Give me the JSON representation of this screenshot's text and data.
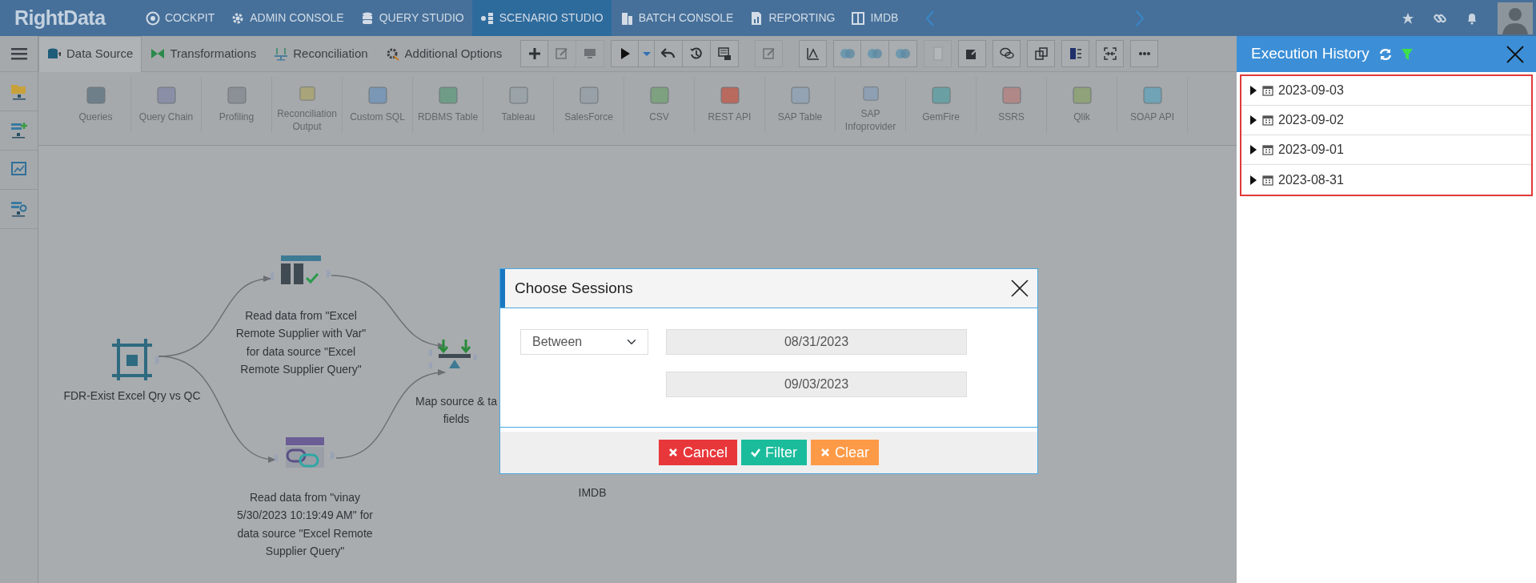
{
  "top_nav": {
    "logo": "RightData",
    "items": [
      {
        "label": "COCKPIT",
        "selected": false
      },
      {
        "label": "ADMIN CONSOLE",
        "selected": false
      },
      {
        "label": "QUERY STUDIO",
        "selected": false
      },
      {
        "label": "SCENARIO STUDIO",
        "selected": true
      },
      {
        "label": "BATCH CONSOLE",
        "selected": false
      },
      {
        "label": "REPORTING",
        "selected": false
      },
      {
        "label": "IMDB",
        "selected": false
      }
    ]
  },
  "tabs": [
    {
      "label": "Data Source",
      "selected": true
    },
    {
      "label": "Transformations",
      "selected": false
    },
    {
      "label": "Reconciliation",
      "selected": false
    },
    {
      "label": "Additional Options",
      "selected": false
    }
  ],
  "toolbar_groups": [
    {
      "buttons": [
        {
          "kind": "add",
          "disabled": false
        },
        {
          "kind": "edit",
          "disabled": true
        },
        {
          "kind": "monitor",
          "disabled": true
        }
      ]
    },
    {
      "buttons": [
        {
          "kind": "run",
          "disabled": false
        },
        {
          "kind": "dropdown",
          "disabled": false
        },
        {
          "kind": "undo",
          "disabled": false
        },
        {
          "kind": "history",
          "disabled": false
        },
        {
          "kind": "schedule",
          "disabled": false
        }
      ]
    },
    {
      "buttons": [
        {
          "kind": "edit",
          "disabled": true
        }
      ]
    },
    {
      "buttons": [
        {
          "kind": "chart",
          "disabled": false
        }
      ]
    },
    {
      "buttons": [
        {
          "kind": "venn",
          "disabled": false
        },
        {
          "kind": "venn",
          "disabled": false
        },
        {
          "kind": "venn",
          "disabled": false
        }
      ]
    },
    {
      "buttons": [
        {
          "kind": "blank",
          "disabled": true
        }
      ]
    },
    {
      "buttons": [
        {
          "kind": "external",
          "disabled": false
        }
      ]
    },
    {
      "buttons": [
        {
          "kind": "chat",
          "disabled": false
        }
      ]
    },
    {
      "buttons": [
        {
          "kind": "copy",
          "disabled": false
        }
      ]
    },
    {
      "buttons": [
        {
          "kind": "panel",
          "disabled": false
        }
      ]
    },
    {
      "buttons": [
        {
          "kind": "collapse",
          "disabled": false
        }
      ]
    },
    {
      "buttons": [
        {
          "kind": "more",
          "disabled": false
        }
      ]
    }
  ],
  "palette": [
    {
      "label": "Queries"
    },
    {
      "label": "Query Chain"
    },
    {
      "label": "Profiling"
    },
    {
      "label": "Reconciliation Output"
    },
    {
      "label": "Custom SQL"
    },
    {
      "label": "RDBMS Table"
    },
    {
      "label": "Tableau"
    },
    {
      "label": "SalesForce"
    },
    {
      "label": "CSV"
    },
    {
      "label": "REST API"
    },
    {
      "label": "SAP Table"
    },
    {
      "label": "SAP Infoprovider"
    },
    {
      "label": "GemFire"
    },
    {
      "label": "SSRS"
    },
    {
      "label": "Qlik"
    },
    {
      "label": "SOAP API"
    }
  ],
  "canvas": {
    "nodes": [
      {
        "kind": "select",
        "label": "FDR-Exist Excel Qry vs QC"
      },
      {
        "kind": "query",
        "label": "Read data from \"Excel Remote Supplier with Var\" for data source \"Excel Remote Supplier Query\""
      },
      {
        "kind": "chain",
        "label": "Read data from \"vinay 5/30/2023 10:19:49 AM\" for data source \"Excel Remote Supplier Query\""
      },
      {
        "kind": "map",
        "label": "Map source & ta fields"
      },
      {
        "kind": "covered",
        "label": "IMDB"
      }
    ]
  },
  "dialog": {
    "title": "Choose Sessions",
    "operator": "Between",
    "from": "08/31/2023",
    "to": "09/03/2023",
    "buttons": [
      {
        "kind": "cancel",
        "label": "Cancel"
      },
      {
        "kind": "filter",
        "label": "Filter"
      },
      {
        "kind": "clear",
        "label": "Clear"
      }
    ]
  },
  "execution_history": {
    "title": "Execution History",
    "sessions": [
      {
        "date": "2023-09-03",
        "expanded": false
      },
      {
        "date": "2023-09-02",
        "expanded": false
      },
      {
        "date": "2023-09-01",
        "expanded": false
      },
      {
        "date": "2023-08-31",
        "expanded": false
      }
    ]
  }
}
